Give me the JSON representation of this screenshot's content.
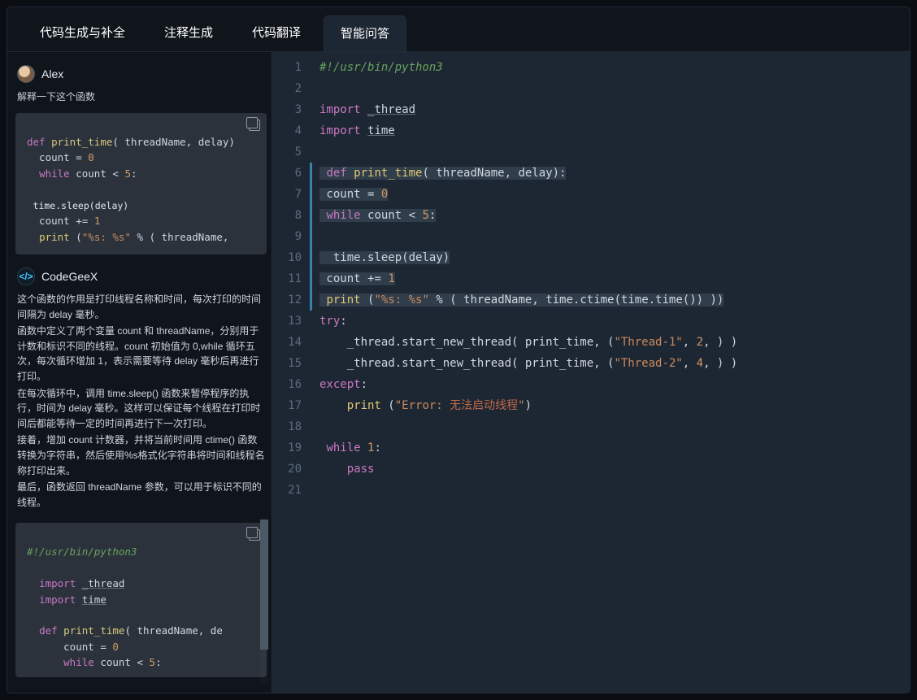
{
  "tabs": {
    "t0": "代码生成与补全",
    "t1": "注释生成",
    "t2": "代码翻译",
    "t3": "智能问答",
    "active_index": 3
  },
  "user": {
    "name": "Alex"
  },
  "prompt": "解释一下这个函数",
  "user_code": {
    "l1": "def print_time( threadName, delay)",
    "l2": "  count = 0",
    "l3": "  while count < 5:",
    "l4": "",
    "l5": " time.sleep(delay)",
    "l6": "  count += 1",
    "l7": "  print (\"%s: %s\" % ( threadName,"
  },
  "brand": {
    "name": "CodeGeeX",
    "logo_text": "</>"
  },
  "answer": {
    "p1": "这个函数的作用是打印线程名称和时间，每次打印的时间间隔为 delay 毫秒。",
    "p2": "函数中定义了两个变量 count 和 threadName，分别用于计数和标识不同的线程。count 初始值为 0,while 循环五次，每次循环增加 1，表示需要等待 delay 毫秒后再进行打印。",
    "p3": "在每次循环中，调用 time.sleep() 函数来暂停程序的执行，时间为 delay 毫秒。这样可以保证每个线程在打印时间后都能等待一定的时间再进行下一次打印。",
    "p4": "接着，增加 count 计数器，并将当前时间用 ctime() 函数转换为字符串，然后使用%s格式化字符串将时间和线程名称打印出来。",
    "p5": "最后，函数返回 threadName 参数，可以用于标识不同的线程。"
  },
  "answer_code": {
    "shebang": "#!/usr/bin/python3",
    "i1": "import _thread",
    "i2": "import time",
    "d1": "def print_time( threadName, de",
    "d2": "    count = 0",
    "d3": "    while count < 5:"
  },
  "editor": {
    "lines": [
      {
        "n": 1,
        "raw": "#!/usr/bin/python3"
      },
      {
        "n": 2,
        "raw": ""
      },
      {
        "n": 3,
        "raw": "import _thread"
      },
      {
        "n": 4,
        "raw": "import time"
      },
      {
        "n": 5,
        "raw": ""
      },
      {
        "n": 6,
        "raw": " def print_time( threadName, delay):"
      },
      {
        "n": 7,
        "raw": " count = 0"
      },
      {
        "n": 8,
        "raw": " while count < 5:"
      },
      {
        "n": 9,
        "raw": ""
      },
      {
        "n": 10,
        "raw": "  time.sleep(delay)"
      },
      {
        "n": 11,
        "raw": " count += 1"
      },
      {
        "n": 12,
        "raw": " print (\"%s: %s\" % ( threadName, time.ctime(time.time()) ))"
      },
      {
        "n": 13,
        "raw": "try:"
      },
      {
        "n": 14,
        "raw": "    _thread.start_new_thread( print_time, (\"Thread-1\", 2, ) )"
      },
      {
        "n": 15,
        "raw": "    _thread.start_new_thread( print_time, (\"Thread-2\", 4, ) )"
      },
      {
        "n": 16,
        "raw": "except:"
      },
      {
        "n": 17,
        "raw": "    print (\"Error: 无法启动线程\")"
      },
      {
        "n": 18,
        "raw": ""
      },
      {
        "n": 19,
        "raw": " while 1:"
      },
      {
        "n": 20,
        "raw": "    pass"
      },
      {
        "n": 21,
        "raw": ""
      }
    ],
    "highlighted_range": [
      6,
      12
    ]
  }
}
